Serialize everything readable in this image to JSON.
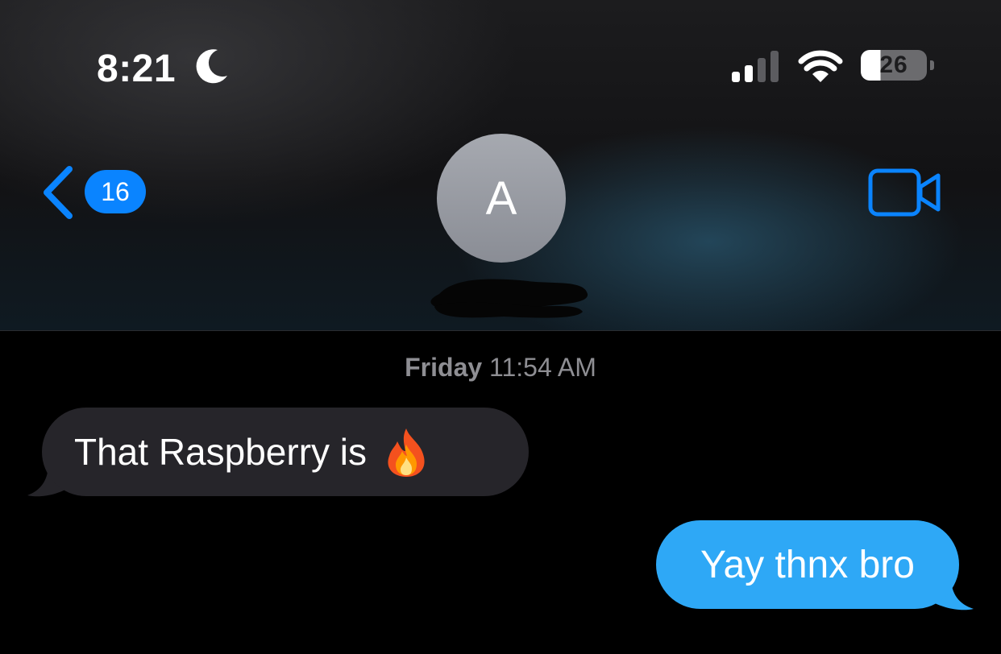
{
  "status_bar": {
    "time": "8:21",
    "focus_icon": "moon-icon",
    "signal_icon": "cellular-signal-icon",
    "signal_bars_active": 2,
    "signal_bars_total": 4,
    "wifi_icon": "wifi-icon",
    "battery_level": "26"
  },
  "nav": {
    "back_icon": "chevron-left-icon",
    "unread_count": "16",
    "contact_initial": "A",
    "contact_name": "",
    "video_icon": "video-camera-icon"
  },
  "conversation": {
    "timestamp_day": "Friday",
    "timestamp_time": "11:54 AM",
    "messages": [
      {
        "direction": "incoming",
        "text": "That Raspberry is",
        "emoji": "fire-emoji"
      },
      {
        "direction": "outgoing",
        "text": "Yay thnx bro"
      }
    ]
  },
  "colors": {
    "accent_blue": "#0a84ff",
    "outgoing_bubble": "#2ea8f6",
    "incoming_bubble": "#26252a",
    "timestamp_gray": "#8e8e93",
    "avatar_gray": "#9a9da4",
    "background": "#000000"
  }
}
